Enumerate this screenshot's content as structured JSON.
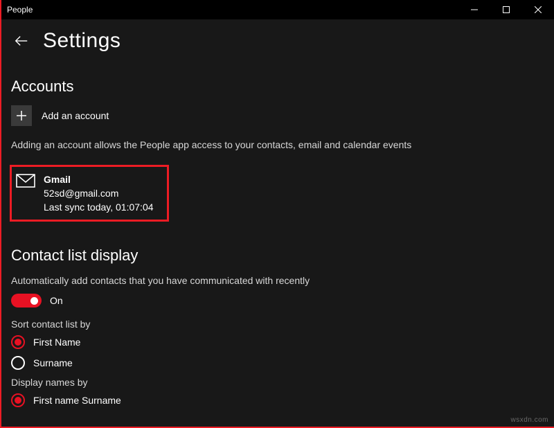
{
  "window": {
    "title": "People"
  },
  "header": {
    "page_title": "Settings"
  },
  "accounts": {
    "heading": "Accounts",
    "add_label": "Add an account",
    "hint": "Adding an account allows the People app access to your contacts, email and calendar events",
    "items": [
      {
        "name": "Gmail",
        "email": "52sd@gmail.com",
        "sync": "Last sync today, 01:07:04"
      }
    ]
  },
  "contact_list": {
    "heading": "Contact list display",
    "auto_add_label": "Automatically add contacts that you have communicated with recently",
    "auto_add_state": "On",
    "sort_label": "Sort contact list by",
    "sort_options": [
      "First Name",
      "Surname"
    ],
    "display_label": "Display names by",
    "display_options": [
      "First name Surname"
    ]
  },
  "watermark": "wsxdn.com"
}
